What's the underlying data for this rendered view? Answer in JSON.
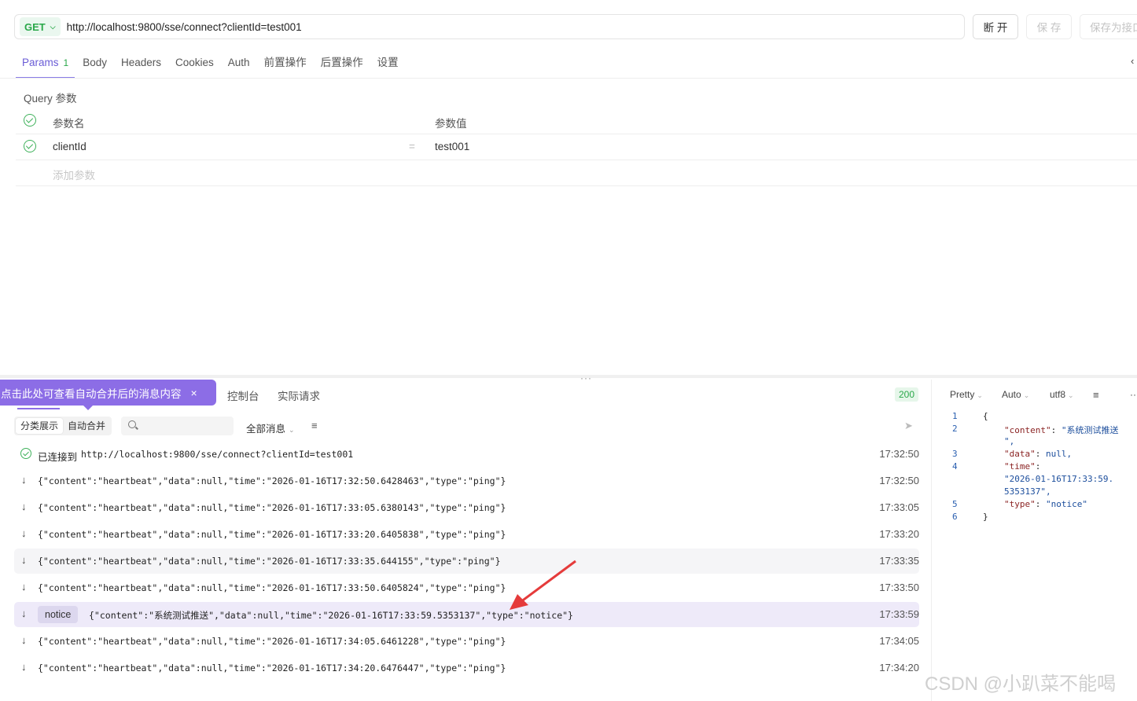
{
  "request": {
    "method": "GET",
    "url": "http://localhost:9800/sse/connect?clientId=test001",
    "buttons": {
      "disconnect": "断 开",
      "save": "保 存",
      "save_as": "保存为接口"
    }
  },
  "request_tabs": [
    {
      "label": "Params",
      "count": "1",
      "active": true
    },
    {
      "label": "Body"
    },
    {
      "label": "Headers"
    },
    {
      "label": "Cookies"
    },
    {
      "label": "Auth"
    },
    {
      "label": "前置操作"
    },
    {
      "label": "后置操作"
    },
    {
      "label": "设置"
    }
  ],
  "params": {
    "section_label": "Query 参数",
    "header_name": "参数名",
    "header_value": "参数值",
    "rows": [
      {
        "name": "clientId",
        "eq": "=",
        "value": "test001"
      }
    ],
    "add_placeholder": "添加参数"
  },
  "response": {
    "tooltip": "点击此处可查看自动合并后的消息内容",
    "tooltip_close": "×",
    "tabs": [
      "控制台",
      "实际请求"
    ],
    "status": "200",
    "view_modes": [
      "分类展示",
      "自动合并"
    ],
    "filter_label": "全部消息",
    "messages": [
      {
        "kind": "connected",
        "label": "已连接到",
        "text": "http://localhost:9800/sse/connect?clientId=test001",
        "time": "17:32:50"
      },
      {
        "kind": "data",
        "text": "{\"content\":\"heartbeat\",\"data\":null,\"time\":\"2026-01-16T17:32:50.6428463\",\"type\":\"ping\"}",
        "time": "17:32:50"
      },
      {
        "kind": "data",
        "text": "{\"content\":\"heartbeat\",\"data\":null,\"time\":\"2026-01-16T17:33:05.6380143\",\"type\":\"ping\"}",
        "time": "17:33:05"
      },
      {
        "kind": "data",
        "text": "{\"content\":\"heartbeat\",\"data\":null,\"time\":\"2026-01-16T17:33:20.6405838\",\"type\":\"ping\"}",
        "time": "17:33:20"
      },
      {
        "kind": "data",
        "text": "{\"content\":\"heartbeat\",\"data\":null,\"time\":\"2026-01-16T17:33:35.644155\",\"type\":\"ping\"}",
        "time": "17:33:35"
      },
      {
        "kind": "data",
        "text": "{\"content\":\"heartbeat\",\"data\":null,\"time\":\"2026-01-16T17:33:50.6405824\",\"type\":\"ping\"}",
        "time": "17:33:50"
      },
      {
        "kind": "notice",
        "tag": "notice",
        "text": "{\"content\":\"系统测试推送\",\"data\":null,\"time\":\"2026-01-16T17:33:59.5353137\",\"type\":\"notice\"}",
        "time": "17:33:59"
      },
      {
        "kind": "data",
        "text": "{\"content\":\"heartbeat\",\"data\":null,\"time\":\"2026-01-16T17:34:05.6461228\",\"type\":\"ping\"}",
        "time": "17:34:05"
      },
      {
        "kind": "data",
        "text": "{\"content\":\"heartbeat\",\"data\":null,\"time\":\"2026-01-16T17:34:20.6476447\",\"type\":\"ping\"}",
        "time": "17:34:20"
      }
    ]
  },
  "preview": {
    "format": "Pretty",
    "mode": "Auto",
    "encoding": "utf8",
    "line_numbers": [
      "1",
      "2",
      "3",
      "4",
      "5",
      "6"
    ],
    "lines": {
      "open": "{",
      "content_key": "\"content\"",
      "content_val_1": "\"系统测试推送",
      "content_val_2": "\",",
      "data_key": "\"data\"",
      "data_val": "null,",
      "time_key": "\"time\"",
      "time_val_1": "\"2026-01-16T17:33:59.",
      "time_val_2": "5353137\",",
      "type_key": "\"type\"",
      "type_val": "\"notice\"",
      "close": "}"
    }
  },
  "watermark": "CSDN @小趴菜不能喝",
  "colors": {
    "accent": "#8c6de6",
    "green": "#2aa84a",
    "notice_bg": "#eeeaf9"
  }
}
